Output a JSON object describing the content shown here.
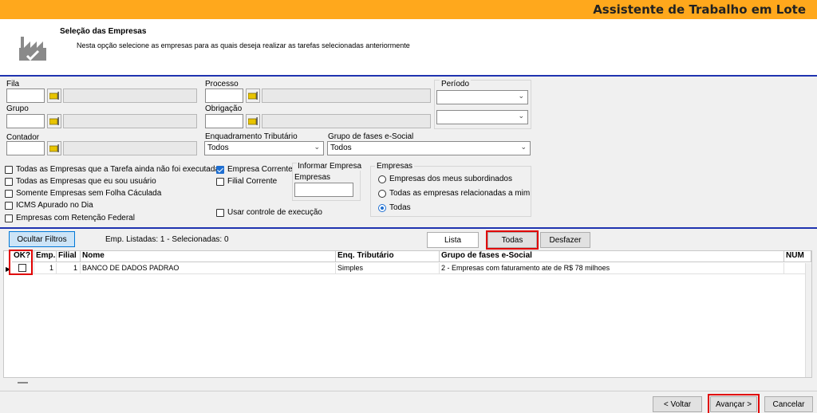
{
  "window": {
    "title": "Assistente de Trabalho em Lote"
  },
  "header": {
    "heading": "Seleção das Empresas",
    "description": "Nesta opção selecione as empresas para as quais deseja realizar as tarefas selecionadas anteriormente",
    "icon": "factory-icon"
  },
  "filters": {
    "fila_label": "Fila",
    "grupo_label": "Grupo",
    "contador_label": "Contador",
    "processo_label": "Processo",
    "obrigacao_label": "Obrigação",
    "periodo_label": "Período",
    "enquadramento_label": "Enquadramento Tributário",
    "enquadramento_value": "Todos",
    "grupo_fases_label": "Grupo de fases e-Social",
    "grupo_fases_value": "Todos",
    "picker_icon": "folder-picker-icon"
  },
  "checkboxes": [
    {
      "label": "Todas as Empresas que a Tarefa ainda não foi executada",
      "checked": false
    },
    {
      "label": "Todas as Empresas que eu sou usuário",
      "checked": false
    },
    {
      "label": "Somente Empresas sem Folha Cáculada",
      "checked": false
    },
    {
      "label": "ICMS Apurado no Dia",
      "checked": false
    },
    {
      "label": "Empresas com Retenção Federal",
      "checked": false
    },
    {
      "label": "Empresa Corrente",
      "checked": true
    },
    {
      "label": "Filial Corrente",
      "checked": false
    },
    {
      "label": "Usar controle de execução",
      "checked": false
    }
  ],
  "informar": {
    "title": "Informar Empresa",
    "label": "Empresas"
  },
  "empresas_group": {
    "title": "Empresas",
    "options": [
      "Empresas dos meus subordinados",
      "Todas as empresas relacionadas a mim",
      "Todas"
    ],
    "selected": "Todas"
  },
  "toolbar": {
    "ocultar_filtros": "Ocultar Filtros",
    "status": "Emp. Listadas: 1 - Selecionadas: 0",
    "lista": "Lista",
    "todas": "Todas",
    "desfazer": "Desfazer"
  },
  "grid": {
    "columns": [
      "OK?",
      "Emp.",
      "Filial",
      "Nome",
      "Enq. Tributário",
      "Grupo de fases e-Social",
      "NUM"
    ],
    "rows": [
      {
        "ok": false,
        "emp": "1",
        "filial": "1",
        "nome": "BANCO DE DADOS PADRAO",
        "enq": "Simples",
        "grupo": "2 - Empresas com faturamento ate de R$ 78 milhoes",
        "num": ""
      }
    ]
  },
  "footer": {
    "voltar": "< Voltar",
    "avancar": "Avançar >",
    "cancelar": "Cancelar"
  },
  "colors": {
    "titlebar": "#ffa81c",
    "divider": "#1f33b0",
    "highlight": "#e00000",
    "accent": "#1f6fd1"
  }
}
